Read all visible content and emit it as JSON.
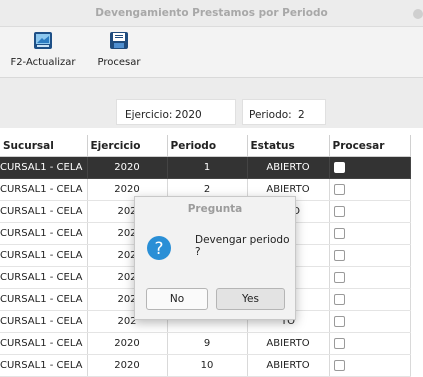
{
  "window": {
    "title": "Devengamiento Prestamos por Periodo"
  },
  "toolbar": {
    "refresh_label": "F2-Actualizar",
    "process_label": "Procesar"
  },
  "form": {
    "ejercicio_label": "Ejercicio:",
    "ejercicio_value": "2020",
    "periodo_label": "Periodo:",
    "periodo_value": "2"
  },
  "table": {
    "columns": [
      "Sucursal",
      "Ejercicio",
      "Periodo",
      "Estatus",
      "Procesar"
    ],
    "rows": [
      {
        "sucursal": "CURSAL1 - CELA",
        "ejercicio": "2020",
        "periodo": "1",
        "estatus": "ABIERTO",
        "procesar": false,
        "selected": true
      },
      {
        "sucursal": "CURSAL1 - CELA",
        "ejercicio": "2020",
        "periodo": "2",
        "estatus": "ABIERTO",
        "procesar": false
      },
      {
        "sucursal": "CURSAL1 - CELA",
        "ejercicio": "202",
        "periodo": "",
        "estatus": "A  TO",
        "procesar": false
      },
      {
        "sucursal": "CURSAL1 - CELA",
        "ejercicio": "202",
        "periodo": "",
        "estatus": "TO",
        "procesar": false
      },
      {
        "sucursal": "CURSAL1 - CELA",
        "ejercicio": "202",
        "periodo": "",
        "estatus": "TO",
        "procesar": false
      },
      {
        "sucursal": "CURSAL1 - CELA",
        "ejercicio": "202",
        "periodo": "",
        "estatus": "TO",
        "procesar": false
      },
      {
        "sucursal": "CURSAL1 - CELA",
        "ejercicio": "202",
        "periodo": "",
        "estatus": "TO",
        "procesar": false
      },
      {
        "sucursal": "CURSAL1 - CELA",
        "ejercicio": "202",
        "periodo": "",
        "estatus": "TO",
        "procesar": false
      },
      {
        "sucursal": "CURSAL1 - CELA",
        "ejercicio": "2020",
        "periodo": "9",
        "estatus": "ABIERTO",
        "procesar": false
      },
      {
        "sucursal": "CURSAL1 - CELA",
        "ejercicio": "2020",
        "periodo": "10",
        "estatus": "ABIERTO",
        "procesar": false
      }
    ]
  },
  "dialog": {
    "title": "Pregunta",
    "message": "Devengar periodo ?",
    "no_label": "No",
    "yes_label": "Yes",
    "icon": "question-icon"
  },
  "colors": {
    "selected_row": "#333333",
    "dialog_icon": "#2a8fd6",
    "status_dot": "#e8734a"
  }
}
